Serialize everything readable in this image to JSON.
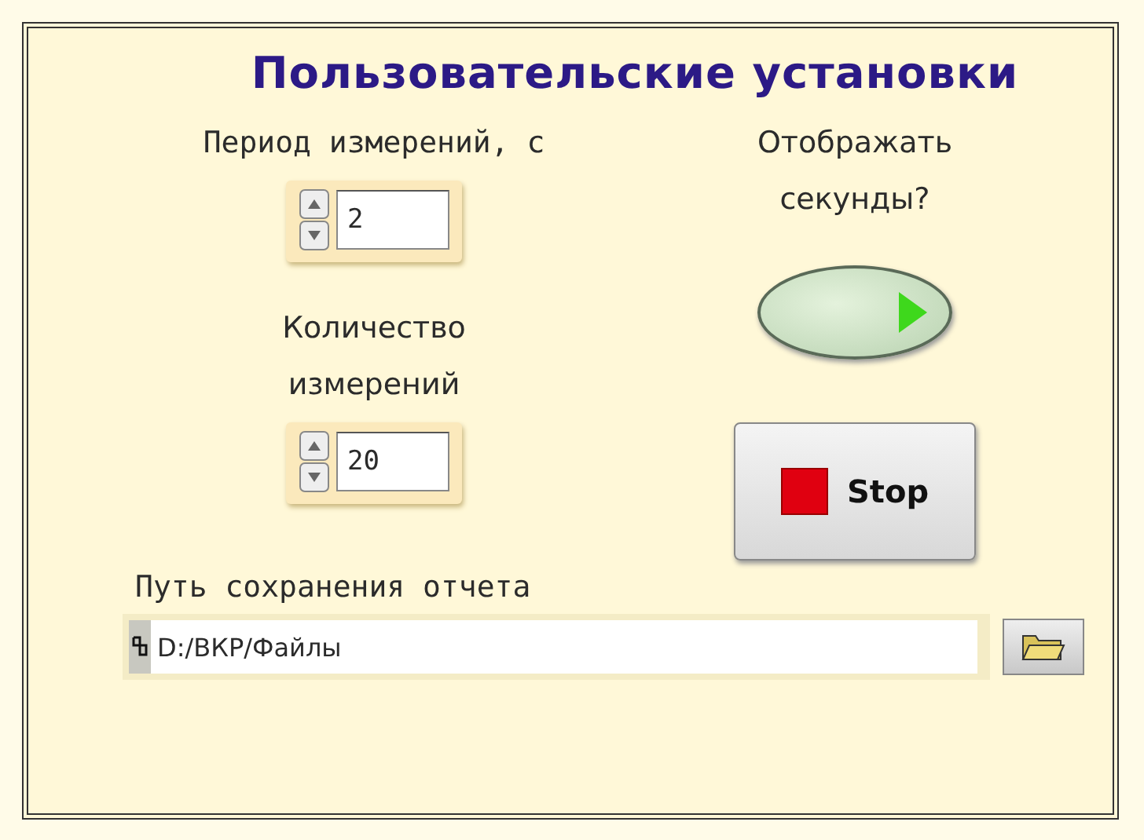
{
  "title": "Пользовательские установки",
  "period": {
    "label": "Период измерений, с",
    "value": "2"
  },
  "count": {
    "label": "Количество измерений",
    "value": "20"
  },
  "show_seconds": {
    "label": "Отображать секунды?",
    "on": true
  },
  "stop_button": {
    "label": "Stop"
  },
  "path": {
    "label": "Путь сохранения отчета",
    "value": "D:/ВКР/Файлы"
  }
}
